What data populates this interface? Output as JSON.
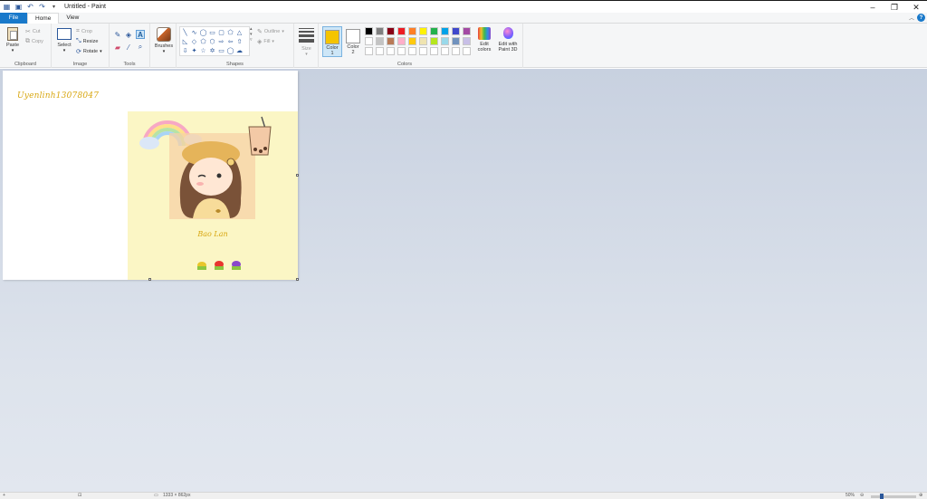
{
  "window": {
    "title": "Untitled - Paint",
    "controls": {
      "minimize": "–",
      "maximize": "❐",
      "close": "✕"
    }
  },
  "quick_access": [
    "paint-app-icon",
    "save-icon",
    "undo-icon",
    "redo-icon",
    "customize-qat-icon"
  ],
  "tabs": [
    {
      "label": "File"
    },
    {
      "label": "Home"
    },
    {
      "label": "View"
    }
  ],
  "ribbon": {
    "clipboard": {
      "group_label": "Clipboard",
      "paste": "Paste",
      "cut": "Cut",
      "copy": "Copy"
    },
    "image": {
      "group_label": "Image",
      "select": "Select",
      "crop": "Crop",
      "resize": "Resize",
      "rotate": "Rotate"
    },
    "tools": {
      "group_label": "Tools",
      "text_glyph": "A"
    },
    "brushes": {
      "label": "Brushes"
    },
    "shapes": {
      "group_label": "Shapes",
      "outline": "Outline",
      "fill": "Fill"
    },
    "size": {
      "label": "Size"
    },
    "colors": {
      "group_label": "Colors",
      "color1_line1": "Color",
      "color1_line2": "1",
      "color2_line1": "Color",
      "color2_line2": "2",
      "color1_value": "#f5c400",
      "color2_value": "#ffffff",
      "edit_colors_line1": "Edit",
      "edit_colors_line2": "colors",
      "edit_3d_line1": "Edit with",
      "edit_3d_line2": "Paint 3D",
      "palette_row1": [
        "#000000",
        "#7f7f7f",
        "#880015",
        "#ed1c24",
        "#ff7f27",
        "#fff200",
        "#22b14c",
        "#00a2e8",
        "#3f48cc",
        "#a349a4"
      ],
      "palette_row2": [
        "#ffffff",
        "#c3c3c3",
        "#b97a57",
        "#ffaec9",
        "#ffc90e",
        "#efe4b0",
        "#b5e61d",
        "#99d9ea",
        "#7092be",
        "#c8bfe7"
      ],
      "palette_row3": [
        "#ffffff",
        "#ffffff",
        "#ffffff",
        "#ffffff",
        "#ffffff",
        "#ffffff",
        "#ffffff",
        "#ffffff",
        "#ffffff",
        "#ffffff"
      ]
    }
  },
  "canvas": {
    "handwritten_text": "Uyenlinh13078047",
    "picture_caption": "Bao Lan"
  },
  "statusbar": {
    "dimensions": "1333 × 862px",
    "zoom": "50%"
  }
}
